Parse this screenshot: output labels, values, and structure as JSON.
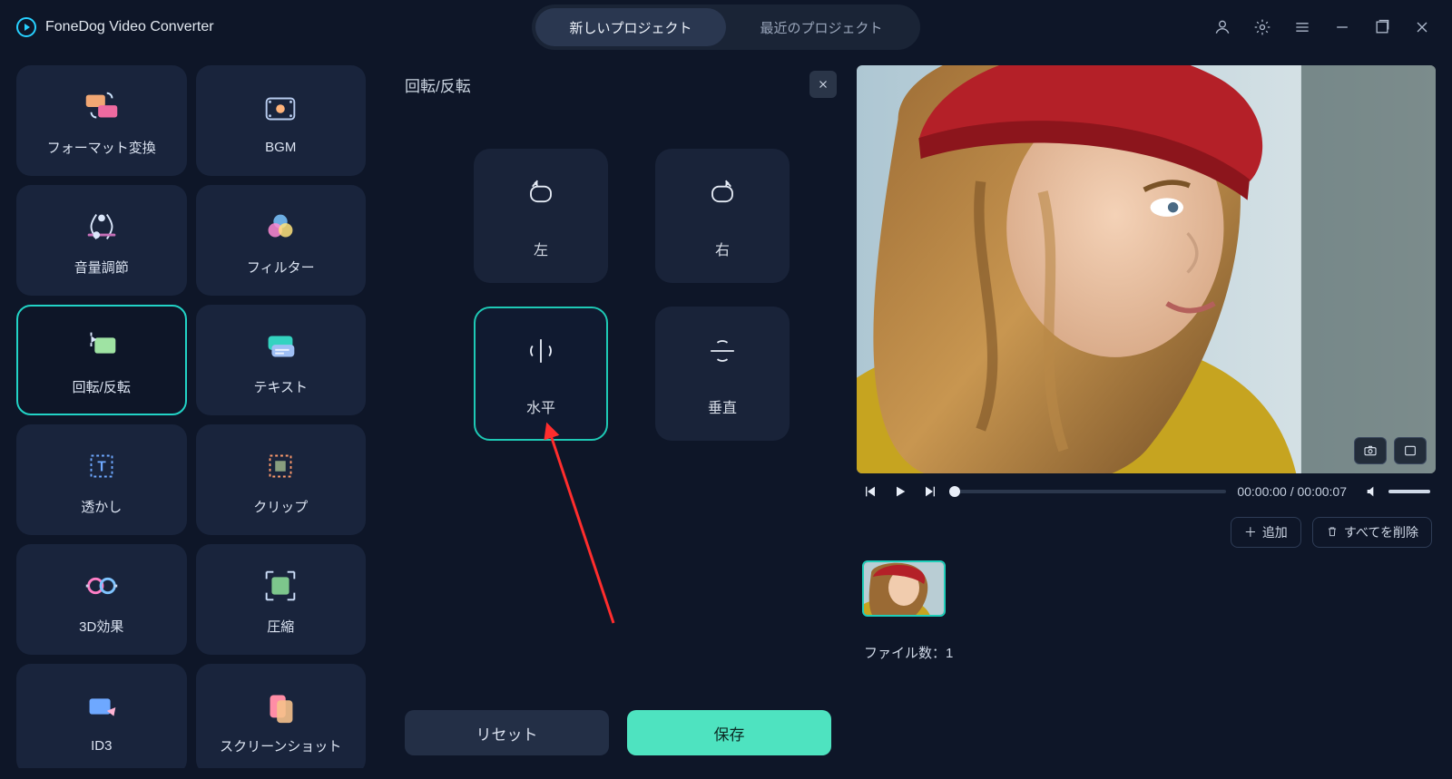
{
  "brand": {
    "title": "FoneDog Video Converter"
  },
  "tabs": {
    "new": "新しいプロジェクト",
    "recent": "最近のプロジェクト"
  },
  "tools": [
    {
      "id": "format",
      "label": "フォーマット変換"
    },
    {
      "id": "bgm",
      "label": "BGM"
    },
    {
      "id": "volume",
      "label": "音量調節"
    },
    {
      "id": "filter",
      "label": "フィルター"
    },
    {
      "id": "rotate",
      "label": "回転/反転",
      "selected": true
    },
    {
      "id": "text",
      "label": "テキスト"
    },
    {
      "id": "watermark",
      "label": "透かし"
    },
    {
      "id": "clip",
      "label": "クリップ"
    },
    {
      "id": "3d",
      "label": "3D効果"
    },
    {
      "id": "compress",
      "label": "圧縮"
    },
    {
      "id": "id3",
      "label": "ID3"
    },
    {
      "id": "screenshot",
      "label": "スクリーンショット"
    }
  ],
  "rotate_panel": {
    "title": "回転/反転",
    "options": {
      "left": "左",
      "right": "右",
      "h": "水平",
      "v": "垂直"
    },
    "selected": "h",
    "reset": "リセット",
    "save": "保存"
  },
  "player": {
    "time": "00:00:00 / 00:00:07"
  },
  "clips": {
    "add": "追加",
    "remove_all": "すべてを削除",
    "file_count_label": "ファイル数：",
    "file_count": "1"
  }
}
